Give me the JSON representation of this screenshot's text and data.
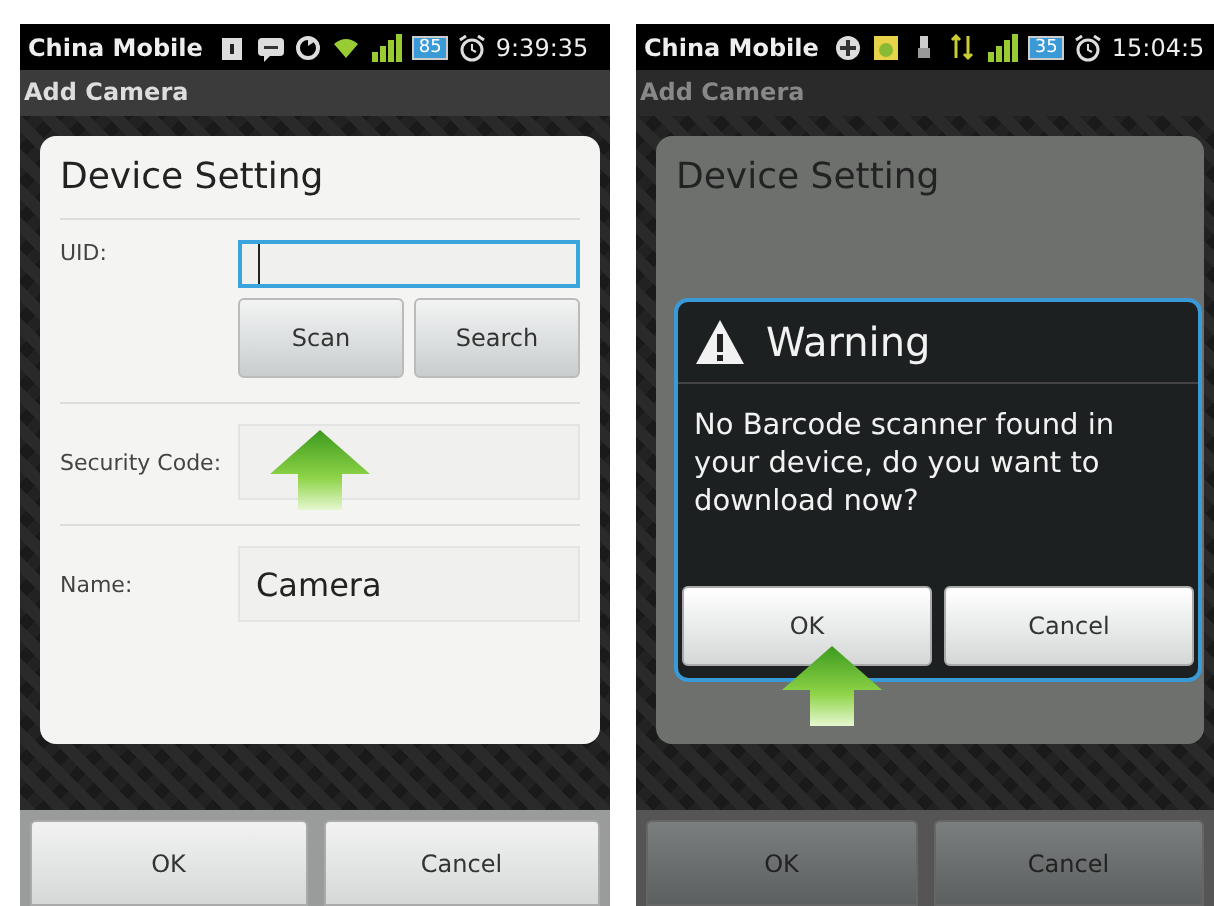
{
  "screens": [
    {
      "dimmed": false,
      "status_bar": {
        "carrier": "China Mobile",
        "battery": "85",
        "time": "9:39:35"
      },
      "title": "Add Camera",
      "dialog": {
        "title": "Device Setting",
        "uid": {
          "label": "UID:",
          "focused": true
        },
        "buttons": [
          "Scan",
          "Search"
        ],
        "security_code": {
          "label": "Security Code:"
        },
        "name": {
          "label": "Name:",
          "value": "Camera"
        }
      },
      "bottom_buttons": [
        "OK",
        "Cancel"
      ]
    },
    {
      "dimmed": true,
      "status_bar": {
        "carrier": "China Mobile",
        "battery": "35",
        "time": "15:04:5"
      },
      "title": "Add Camera",
      "dialog": {
        "title": "Device Setting"
      },
      "alert": {
        "title": "Warning",
        "message": "No Barcode scanner found in your device, do you want to download now?",
        "buttons": [
          "OK",
          "Cancel"
        ]
      },
      "bottom_buttons": [
        "OK",
        "Cancel"
      ]
    }
  ]
}
